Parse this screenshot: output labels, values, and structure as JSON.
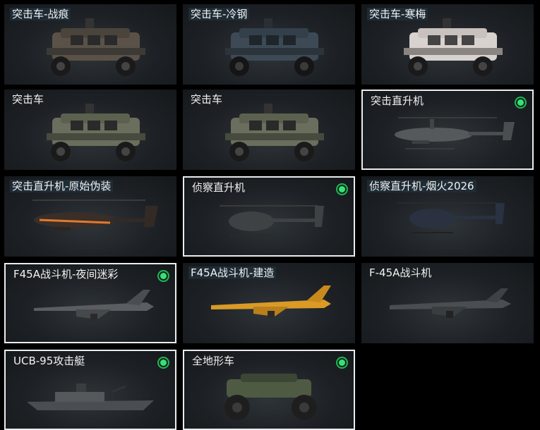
{
  "items": [
    {
      "label": "突击车-战痕",
      "equipped": false
    },
    {
      "label": "突击车-冷钢",
      "equipped": false
    },
    {
      "label": "突击车-寒梅",
      "equipped": false
    },
    {
      "label": "突击车",
      "equipped": false
    },
    {
      "label": "突击车",
      "equipped": false
    },
    {
      "label": "突击直升机",
      "equipped": true
    },
    {
      "label": "突击直升机-原始伪装",
      "equipped": false
    },
    {
      "label": "侦察直升机",
      "equipped": true
    },
    {
      "label": "侦察直升机-烟火2026",
      "equipped": false
    },
    {
      "label": "F45A战斗机-夜间迷彩",
      "equipped": true
    },
    {
      "label": "F45A战斗机-建造",
      "equipped": false
    },
    {
      "label": "F-45A战斗机",
      "equipped": false
    },
    {
      "label": "UCB-95攻击艇",
      "equipped": true
    },
    {
      "label": "全地形车",
      "equipped": true
    }
  ],
  "colors": {
    "selected_border": "#e9ecee",
    "equipped_badge": "#39e07a",
    "card_bg": "#1d2125"
  },
  "icons": {
    "equipped": "green-dot-icon"
  }
}
